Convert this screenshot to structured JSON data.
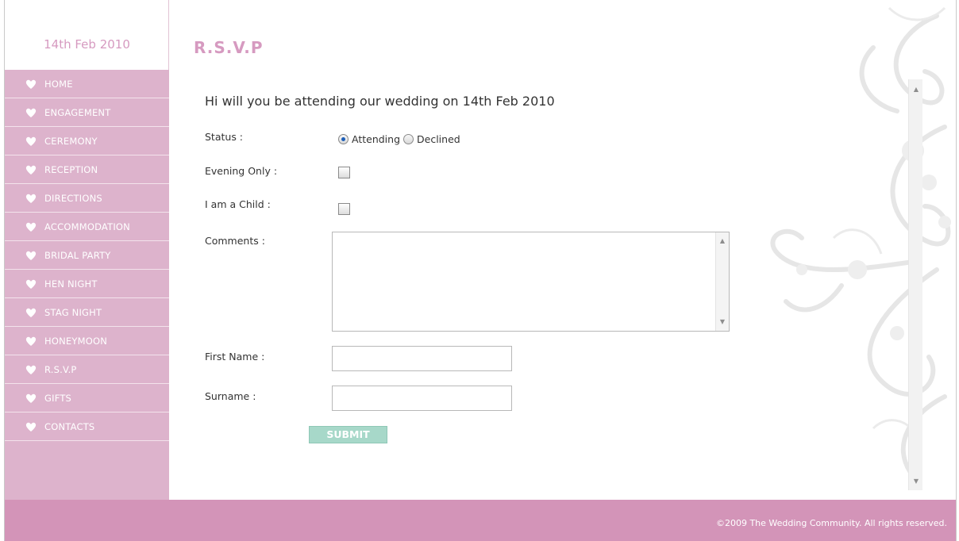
{
  "sidebar": {
    "date": "14th Feb 2010",
    "items": [
      {
        "label": "HOME"
      },
      {
        "label": "ENGAGEMENT"
      },
      {
        "label": "CEREMONY"
      },
      {
        "label": "RECEPTION"
      },
      {
        "label": "DIRECTIONS"
      },
      {
        "label": "ACCOMMODATION"
      },
      {
        "label": "BRIDAL PARTY"
      },
      {
        "label": "HEN NIGHT"
      },
      {
        "label": "STAG NIGHT"
      },
      {
        "label": "HONEYMOON"
      },
      {
        "label": "R.S.V.P"
      },
      {
        "label": "GIFTS"
      },
      {
        "label": "CONTACTS"
      }
    ],
    "icon": "heart-icon"
  },
  "main": {
    "title": "R.S.V.P",
    "question": "Hi will you be attending our wedding on 14th Feb 2010",
    "form": {
      "status_label": "Status :",
      "status_options": [
        "Attending",
        "Declined"
      ],
      "status_selected": "Attending",
      "evening_label": "Evening Only :",
      "evening_checked": false,
      "child_label": "I am a Child :",
      "child_checked": false,
      "comments_label": "Comments :",
      "comments_value": "",
      "first_name_label": "First Name :",
      "first_name_value": "",
      "surname_label": "Surname :",
      "surname_value": "",
      "submit_label": "SUBMIT"
    }
  },
  "footer": {
    "copyright": "©2009 The Wedding Community. All rights reserved."
  },
  "colors": {
    "accent_pink": "#d69ac0",
    "sidebar_bg": "#ddb3cc",
    "footer_bg": "#d394b8",
    "submit_bg": "#a7d8c9"
  }
}
